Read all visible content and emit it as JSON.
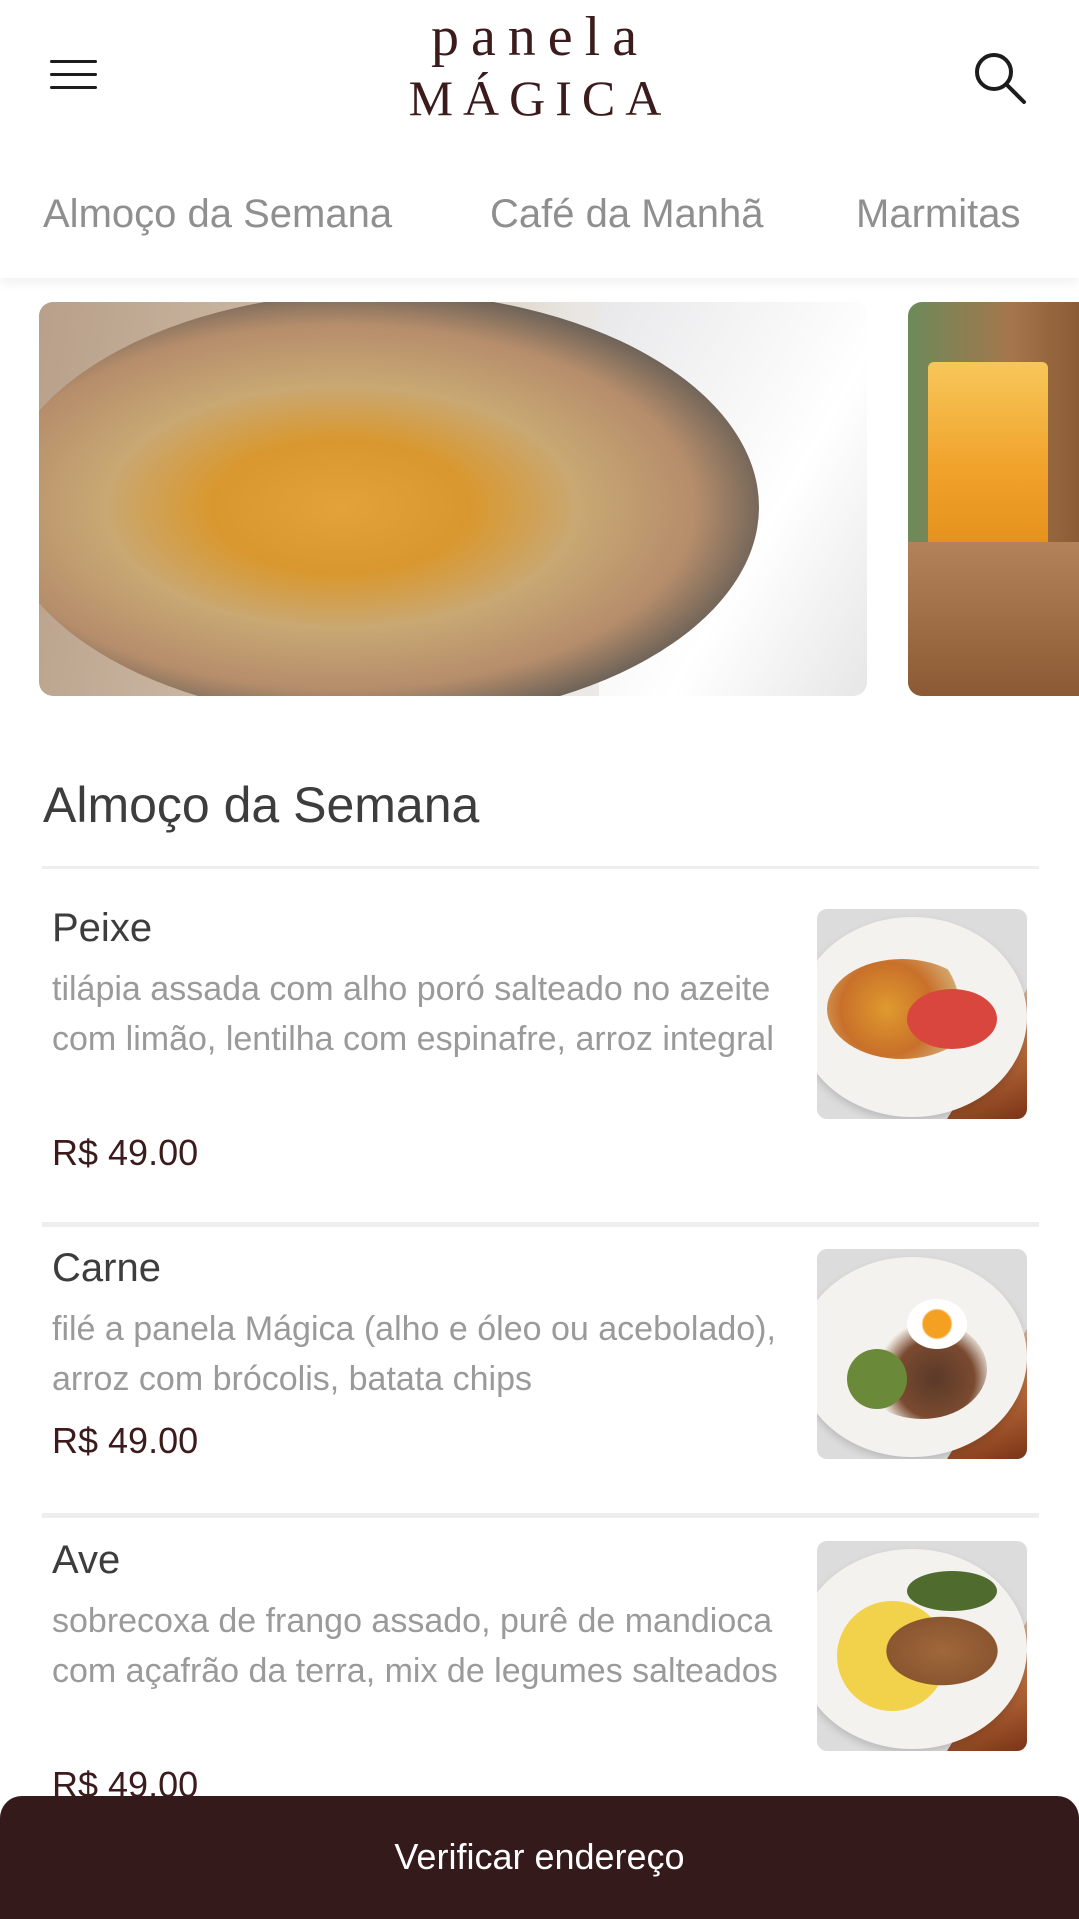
{
  "header": {
    "logo_line1": "panela",
    "logo_line2": "MÁGICA",
    "menu_icon": "hamburger-menu-icon",
    "search_icon": "search-icon"
  },
  "tabs": [
    {
      "label": "Almoço da Semana"
    },
    {
      "label": "Café da Manhã"
    },
    {
      "label": "Marmitas"
    }
  ],
  "section": {
    "title": "Almoço da Semana"
  },
  "items": [
    {
      "name": "Peixe",
      "description": "tilápia assada com alho poró salteado no azeite com limão, lentilha com espinafre, arroz integral",
      "price": "R$ 49.00"
    },
    {
      "name": "Carne",
      "description": "filé a panela Mágica (alho e óleo ou acebolado), arroz com brócolis, batata chips",
      "price": "R$ 49.00"
    },
    {
      "name": "Ave",
      "description": "sobrecoxa de frango assado, purê de mandioca com açafrão da terra, mix de legumes salteados",
      "price": "R$ 49.00"
    }
  ],
  "cta": {
    "label": "Verificar endereço"
  },
  "colors": {
    "brand_dark": "#351a1c",
    "logo": "#3b1b1c",
    "tab_text": "#8f8f8f",
    "desc_text": "#9a9a9a"
  }
}
